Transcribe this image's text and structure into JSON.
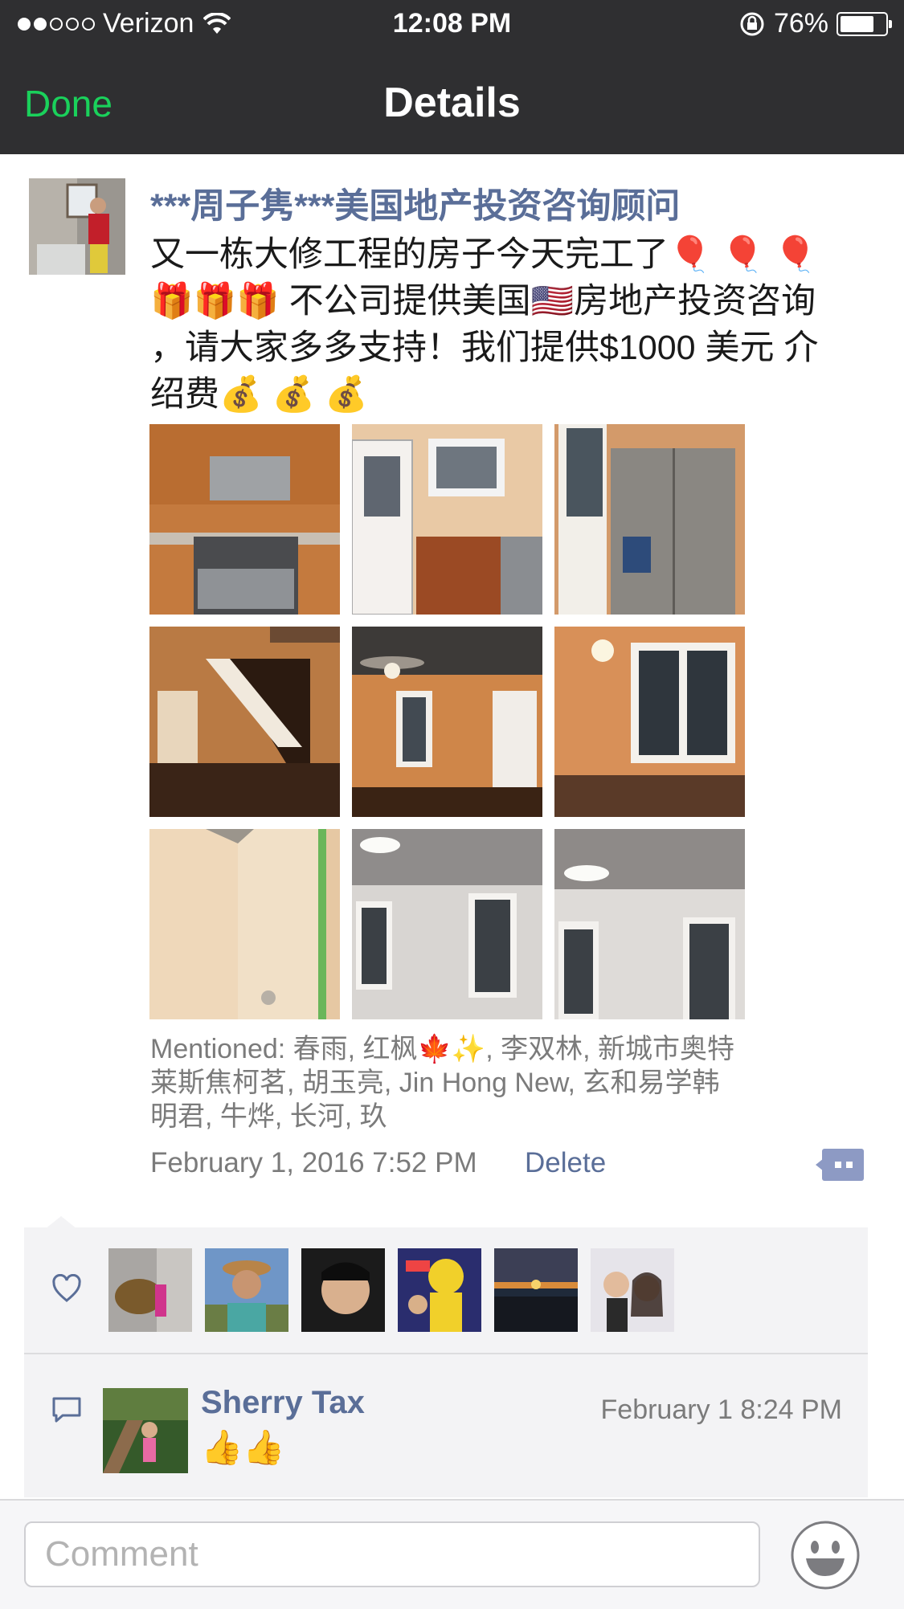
{
  "status_bar": {
    "carrier": "Verizon",
    "time": "12:08 PM",
    "battery": "76%",
    "battery_level": 0.76,
    "signal_bars_filled": 2,
    "signal_bars_total": 5
  },
  "nav": {
    "done_label": "Done",
    "title": "Details"
  },
  "post": {
    "author": "***周子隽***美国地产投资咨询顾问",
    "text_line1": "又一栋大修工程的房子今天完工了",
    "text_line2_a": "不公司提供美国",
    "text_line2_b": "房地产投资咨询",
    "text_line3": "，请大家多多支持！我们提供$1000 美元 介",
    "text_line4": "绍费",
    "emoji_balloon": "🎈",
    "emoji_gift": "🎁",
    "emoji_flag": "🇺🇸",
    "emoji_money": "💰",
    "mentioned": "Mentioned: 春雨, 红枫🍁✨, 李双林, 新城市奥特莱斯焦柯茗, 胡玉亮, Jin Hong New, 玄和易学韩明君, 牛烨, 长河, 玖",
    "date": "February 1, 2016 7:52 PM",
    "delete_label": "Delete",
    "photos": [
      "kitchen-stove-icon",
      "kitchen-sink-icon",
      "refrigerator-icon",
      "staircase-icon",
      "ceiling-fan-room-icon",
      "window-room-icon",
      "bathroom-wall-icon",
      "white-room-icon",
      "white-room-window-icon"
    ]
  },
  "likes": {
    "avatars": [
      "liker-avatar-1",
      "liker-avatar-2",
      "liker-avatar-3",
      "liker-avatar-4",
      "liker-avatar-5",
      "liker-avatar-6"
    ]
  },
  "comment": {
    "name": "Sherry Tax",
    "time": "February 1 8:24 PM",
    "text": "👍👍"
  },
  "input": {
    "placeholder": "Comment"
  },
  "colors": {
    "link_blue": "#5a6e98",
    "done_green": "#1ad15b",
    "header_bg": "#2f2f31",
    "feedback_bg": "#f3f3f5"
  }
}
